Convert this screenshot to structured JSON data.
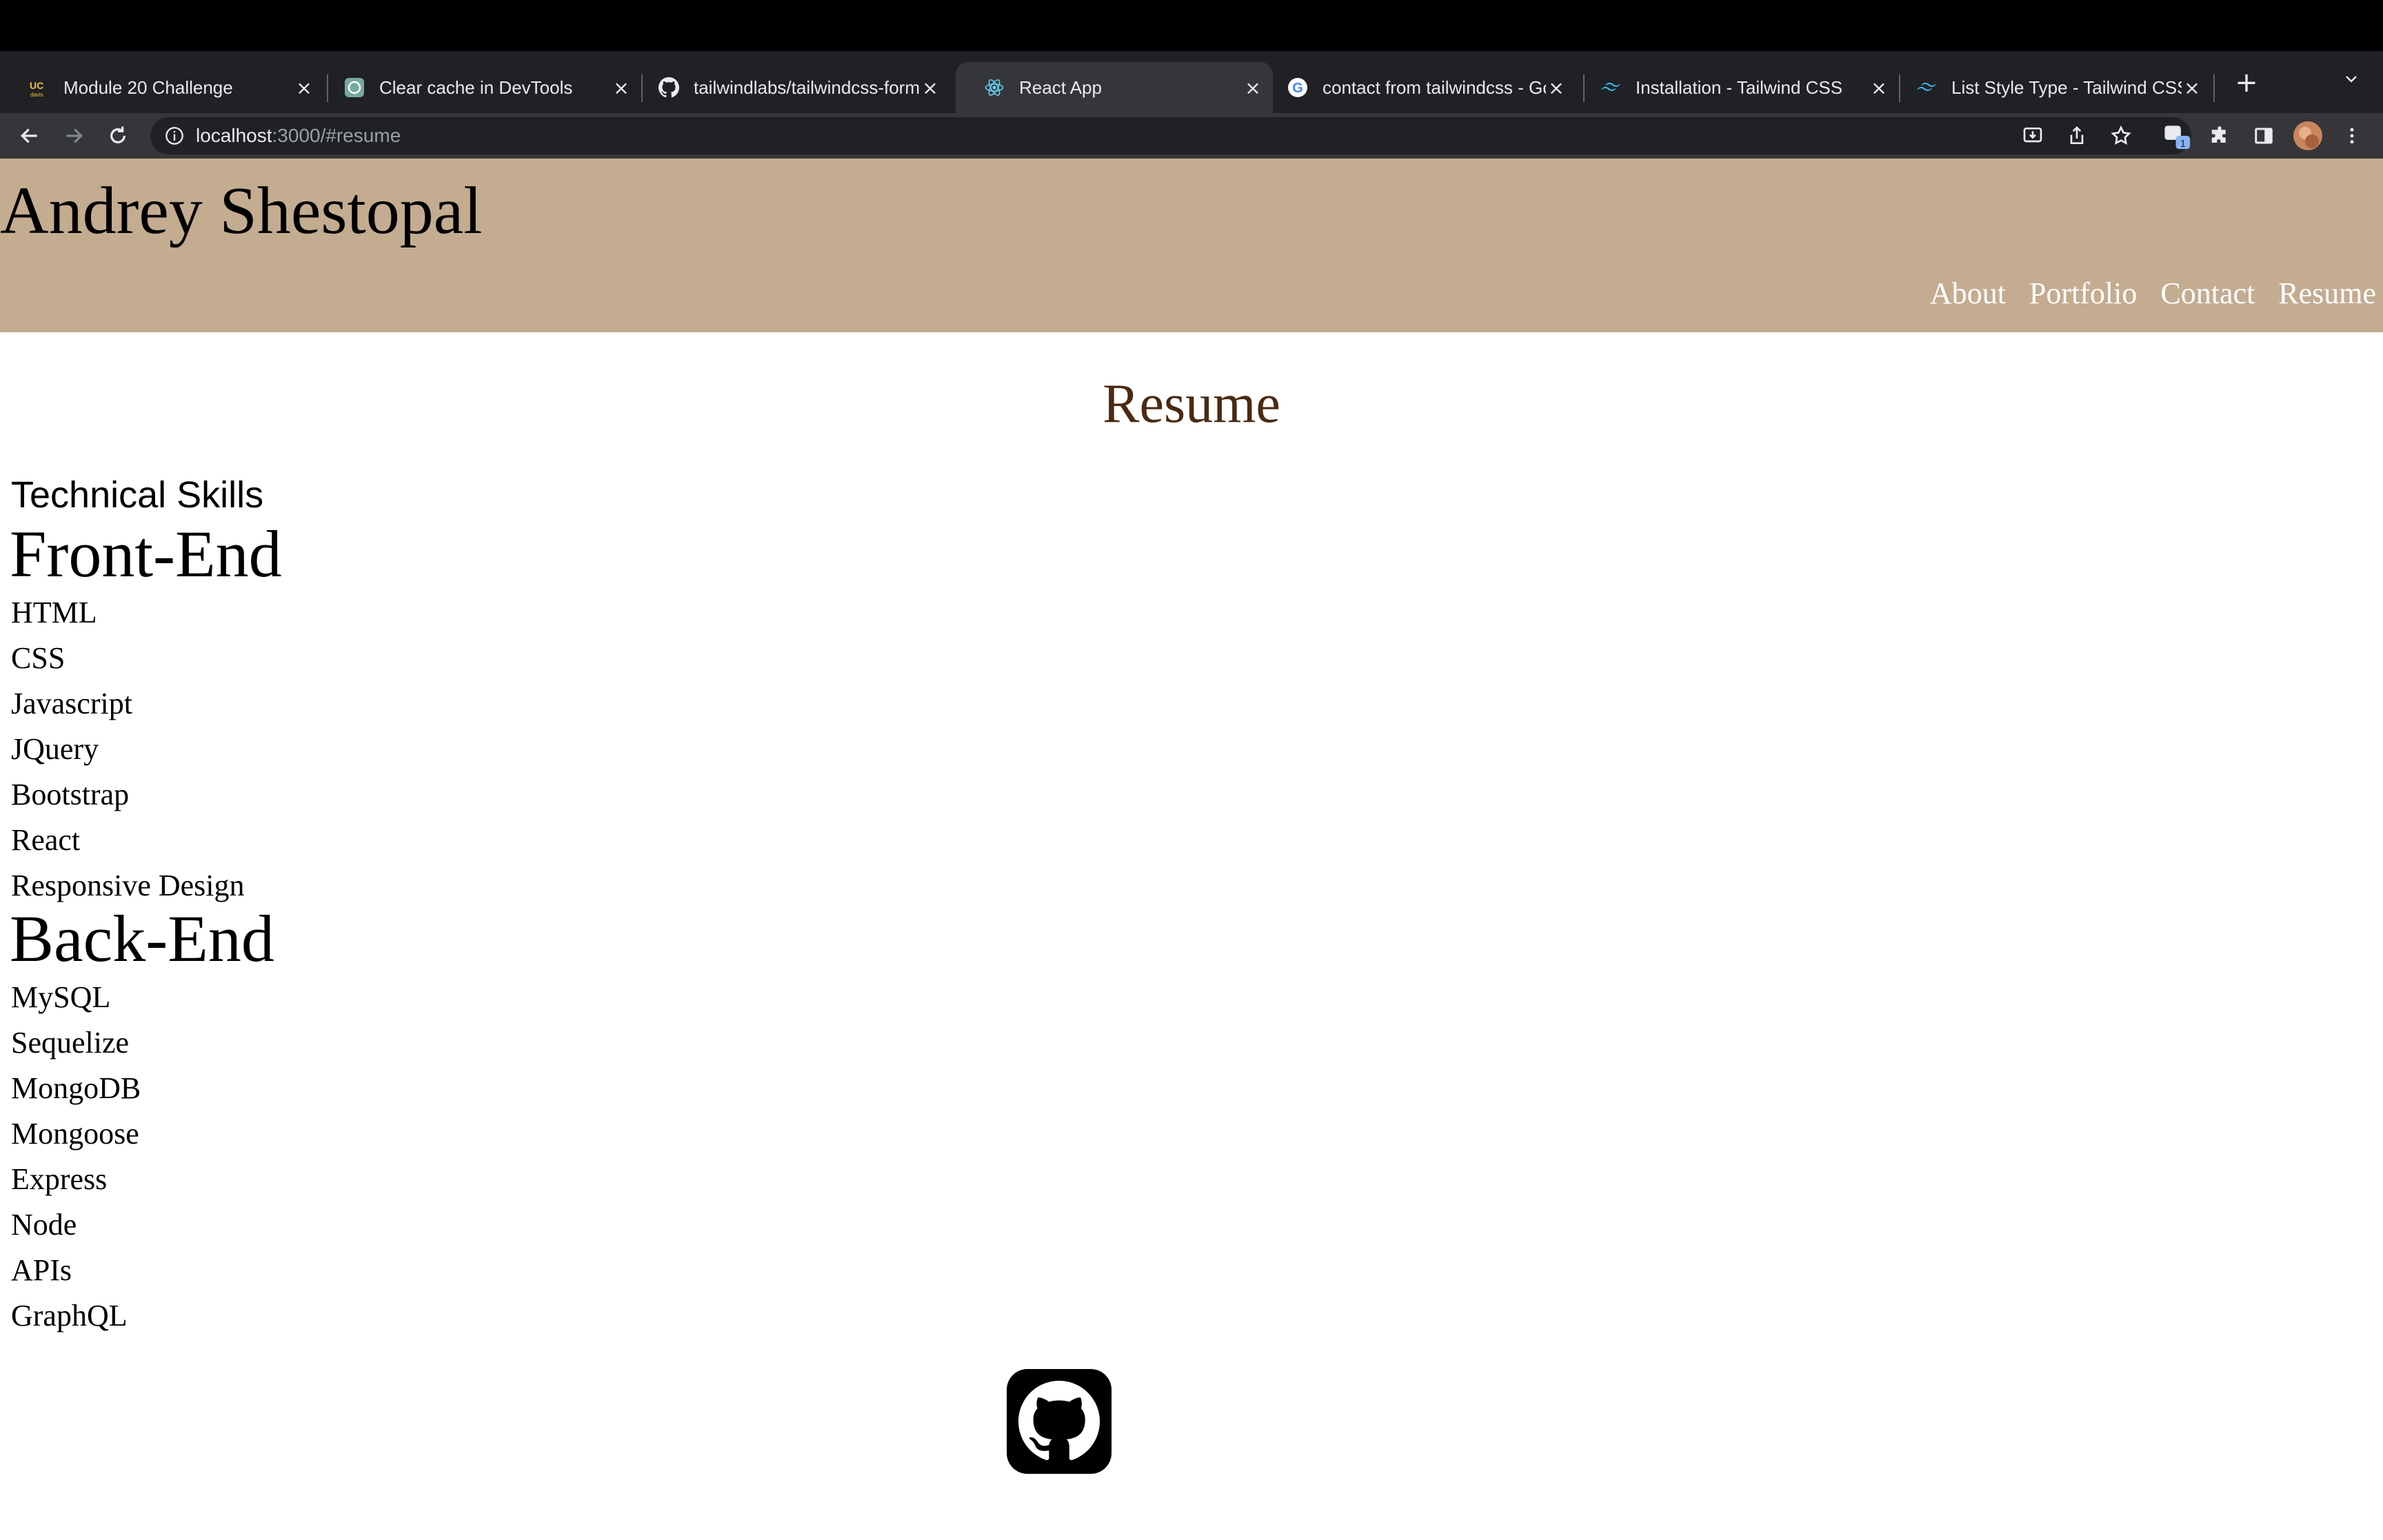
{
  "browser": {
    "tabs": [
      {
        "title": "Module 20 Challenge",
        "icon": "bootcamp-icon",
        "active": false
      },
      {
        "title": "Clear cache in DevTools",
        "icon": "chatgpt-icon",
        "active": false
      },
      {
        "title": "tailwindlabs/tailwindcss-form",
        "icon": "github-icon",
        "active": false
      },
      {
        "title": "React App",
        "icon": "react-icon",
        "active": true
      },
      {
        "title": "contact from tailwindcss - Go",
        "icon": "google-icon",
        "active": false
      },
      {
        "title": "Installation - Tailwind CSS",
        "icon": "tailwind-icon",
        "active": false
      },
      {
        "title": "List Style Type - Tailwind CSS",
        "icon": "tailwind-icon",
        "active": false
      }
    ],
    "address": {
      "host": "localhost",
      "rest": ":3000/#resume"
    },
    "extension_badge": "1"
  },
  "site": {
    "name": "Andrey Shestopal",
    "nav": [
      "About",
      "Portfolio",
      "Contact",
      "Resume"
    ]
  },
  "resume": {
    "title": "Resume",
    "skills_heading": "Technical Skills",
    "front_end": {
      "heading": "Front-End",
      "items": [
        "HTML",
        "CSS",
        "Javascript",
        "JQuery",
        "Bootstrap",
        "React",
        "Responsive Design"
      ]
    },
    "back_end": {
      "heading": "Back-End",
      "items": [
        "MySQL",
        "Sequelize",
        "MongoDB",
        "Mongoose",
        "Express",
        "Node",
        "APIs",
        "GraphQL"
      ]
    }
  },
  "footer": {
    "link_icon": "github-icon"
  },
  "colors": {
    "header_bg": "#c4ac91",
    "page_title": "#4a2a12",
    "nav_text": "#ffffff"
  }
}
